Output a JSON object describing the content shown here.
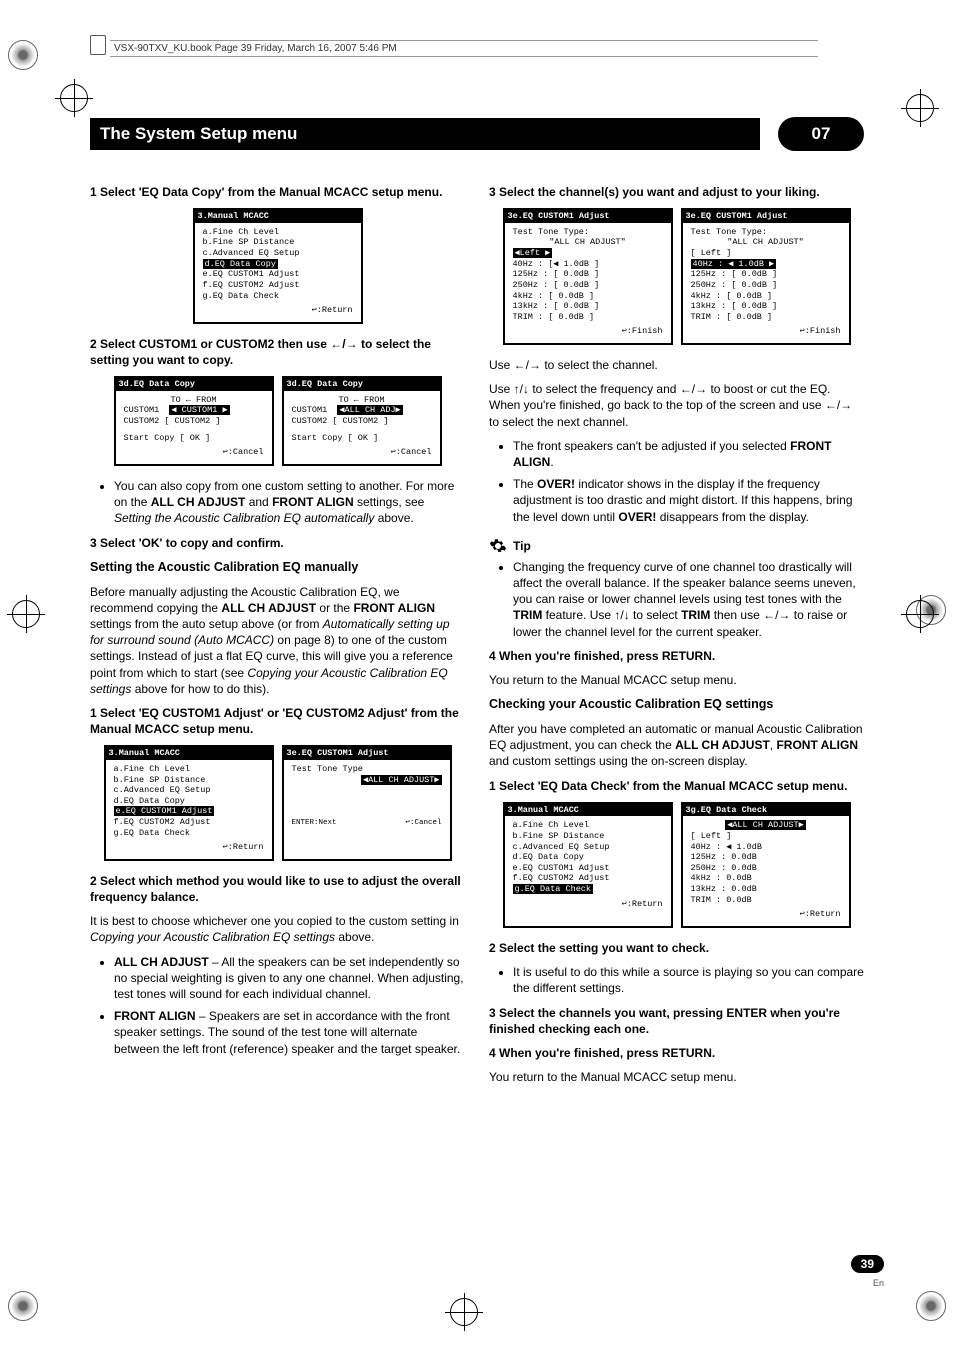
{
  "header_strip": "VSX-90TXV_KU.book  Page 39  Friday, March 16, 2007  5:46 PM",
  "title_bar": {
    "title": "The System Setup menu",
    "chapter": "07"
  },
  "left": {
    "step1": "1    Select 'EQ Data Copy' from the Manual MCACC setup menu.",
    "osd1": {
      "title": "3.Manual  MCACC",
      "lines": [
        "a.Fine  Ch  Level",
        "b.Fine  SP  Distance",
        "c.Advanced  EQ  Setup"
      ],
      "hl": "d.EQ  Data  Copy",
      "after": [
        "e.EQ  CUSTOM1  Adjust",
        "f.EQ  CUSTOM2  Adjust",
        "g.EQ  Data  Check"
      ],
      "foot": "↩:Return"
    },
    "step2": "2    Select CUSTOM1 or CUSTOM2 then use ←/→ to select the setting you want to copy.",
    "osd2a": {
      "title": "3d.EQ  Data  Copy",
      "t_hdr": "TO    ←    FROM",
      "row1a": "CUSTOM1",
      "row1b_hl": "◀  CUSTOM1  ▶",
      "row2a": "CUSTOM2  [",
      "row2b": "CUSTOM2  ]",
      "start": "Start  Copy          [   OK   ]",
      "foot": "↩:Cancel"
    },
    "osd2b": {
      "title": "3d.EQ  Data  Copy",
      "t_hdr": "TO    ←    FROM",
      "row1a": "CUSTOM1",
      "row1b_hl": "◀ALL  CH  ADJ▶",
      "row2a": "CUSTOM2  [",
      "row2b": "CUSTOM2  ]",
      "start": "Start  Copy          [   OK   ]",
      "foot": "↩:Cancel"
    },
    "bullet_copy": "You can also copy from one custom setting to another. For more on the ",
    "bullet_copy_b1": "ALL CH ADJUST",
    "bullet_copy_mid": " and ",
    "bullet_copy_b2": "FRONT ALIGN",
    "bullet_copy_end": " settings, see ",
    "bullet_copy_i": "Setting the Acoustic Calibration EQ automatically",
    "bullet_copy_tail": " above.",
    "step3": "3    Select 'OK' to copy and confirm.",
    "heading_manual": "Setting the Acoustic Calibration EQ manually",
    "para_manual_1": "Before manually adjusting the Acoustic Calibration EQ, we recommend copying the ",
    "para_manual_b1": "ALL CH ADJUST",
    "para_manual_mid": " or the ",
    "para_manual_b2": "FRONT ALIGN",
    "para_manual_2": " settings from the auto setup above (or from ",
    "para_manual_i1": "Automatically setting up for surround sound (Auto MCACC)",
    "para_manual_3": " on page 8) to one of the custom settings. Instead of just a flat EQ curve, this will give you a reference point from which to start (see ",
    "para_manual_i2": "Copying your Acoustic Calibration EQ settings",
    "para_manual_4": " above for how to do this).",
    "step_m1": "1    Select 'EQ CUSTOM1 Adjust' or 'EQ CUSTOM2 Adjust' from the Manual MCACC setup menu.",
    "osd3a": {
      "title": "3.Manual  MCACC",
      "lines": [
        "a.Fine  Ch  Level",
        "b.Fine  SP  Distance",
        "c.Advanced  EQ  Setup",
        "d.EQ  Data  Copy"
      ],
      "hl": "e.EQ  CUSTOM1  Adjust",
      "after": [
        "f.EQ  CUSTOM2  Adjust",
        "g.EQ  Data  Check"
      ],
      "foot": "↩:Return"
    },
    "osd3b": {
      "title": "3e.EQ  CUSTOM1  Adjust",
      "label": "Test Tone Type",
      "hl": "◀ALL  CH  ADJUST▶",
      "foot_l": "ENTER:Next",
      "foot_r": "↩:Cancel"
    },
    "step_m2": "2    Select which method you would like to use to adjust the overall frequency balance.",
    "para_m2": "It is best to choose whichever one you copied to the custom setting in ",
    "para_m2_i": "Copying your Acoustic Calibration EQ settings",
    "para_m2_tail": " above.",
    "bullet_allch_b": "ALL CH ADJUST",
    "bullet_allch": " – All the speakers can be set independently so no special weighting is given to any one channel. When adjusting, test tones will sound for each individual channel.",
    "bullet_front_b": "FRONT ALIGN",
    "bullet_front": " – Speakers are set in accordance with the front speaker settings. The sound of the test tone will alternate between the left front (reference) speaker and the target speaker."
  },
  "right": {
    "step3": "3    Select the channel(s) you want and adjust to your liking.",
    "osd4a": {
      "title": "3e.EQ  CUSTOM1  Adjust",
      "sub1": "Test Tone Type:",
      "sub2": "\"ALL  CH  ADJUST\"",
      "ch_hl": "◀Left             ▶",
      "rows": [
        "40Hz :   [◀   1.0dB  ]",
        "125Hz :  [    0.0dB  ]",
        "250Hz :  [    0.0dB  ]",
        "4kHz :   [    0.0dB  ]",
        "13kHz :  [    0.0dB  ]",
        "TRIM :   [    0.0dB  ]"
      ],
      "foot": "↩:Finish"
    },
    "osd4b": {
      "title": "3e.EQ  CUSTOM1  Adjust",
      "sub1": "Test Tone Type:",
      "sub2": "\"ALL  CH  ADJUST\"",
      "ch": "[ Left            ]",
      "rows": [
        "40Hz :   ◀    1.0dB  ▶",
        "125Hz :  [    0.0dB  ]",
        "250Hz :  [    0.0dB  ]",
        "4kHz :   [    0.0dB  ]",
        "13kHz :  [    0.0dB  ]",
        "TRIM :   [    0.0dB  ]"
      ],
      "row_hl_idx": 0,
      "foot": "↩:Finish"
    },
    "use1": "Use ←/→ to select the channel.",
    "use2": "Use ↑/↓ to select the frequency and ←/→ to boost or cut the EQ. When you're finished, go back to the top of the screen and use ←/→ to select the next channel.",
    "bullet_fa_pre": "The front speakers can't be adjusted if you selected ",
    "bullet_fa_b": "FRONT ALIGN",
    "bullet_fa_post": ".",
    "bullet_over_1": "The ",
    "bullet_over_b1": "OVER!",
    "bullet_over_2": " indicator shows in the display if the frequency adjustment is too drastic and might distort. If this happens, bring the level down until ",
    "bullet_over_b2": "OVER!",
    "bullet_over_3": " disappears from the display.",
    "tip_label": "Tip",
    "tip_text_1": "Changing the frequency curve of one channel too drastically will affect the overall balance. If the speaker balance seems uneven, you can raise or lower channel levels using test tones with the ",
    "tip_b1": "TRIM",
    "tip_text_2": " feature. Use ↑/↓ to select ",
    "tip_b2": "TRIM",
    "tip_text_3": " then use ←/→ to raise or lower the channel level for the current speaker.",
    "step4": "4    When you're finished, press RETURN.",
    "step4_sub": "You return to the Manual MCACC setup menu.",
    "heading_check": "Checking your Acoustic Calibration EQ settings",
    "para_check_1": "After you have completed an automatic or manual Acoustic Calibration EQ adjustment, you can check the ",
    "para_check_b1": "ALL CH ADJUST",
    "para_check_mid": ", ",
    "para_check_b2": "FRONT ALIGN",
    "para_check_2": " and custom settings using the on-screen display.",
    "step_c1": "1    Select 'EQ Data Check' from the Manual MCACC setup menu.",
    "osd5a": {
      "title": "3.Manual  MCACC",
      "lines": [
        "a.Fine  Ch  Level",
        "b.Fine  SP  Distance",
        "c.Advanced  EQ  Setup",
        "d.EQ  Data  Copy",
        "e.EQ  CUSTOM1  Adjust",
        "f.EQ  CUSTOM2  Adjust"
      ],
      "hl": "g.EQ  Data  Check",
      "foot": "↩:Return"
    },
    "osd5b": {
      "title": "3g.EQ  Data  Check",
      "hl": "◀ALL  CH  ADJUST▶",
      "ch": "[ Left           ]",
      "rows": [
        "40Hz : ◀  1.0dB",
        "125Hz :    0.0dB",
        "250Hz :    0.0dB",
        "4kHz :     0.0dB",
        "13kHz :    0.0dB",
        "TRIM :     0.0dB"
      ],
      "foot": "↩:Return"
    },
    "step_c2": "2    Select the setting you want to check.",
    "bullet_c2": "It is useful to do this while a source is playing so you can compare the different settings.",
    "step_c3": "3    Select the channels you want, pressing ENTER when you're finished checking each one.",
    "step_c4": "4    When you're finished, press RETURN.",
    "step_c4_sub": "You return to the Manual MCACC setup menu."
  },
  "footer": {
    "page": "39",
    "lang": "En"
  }
}
